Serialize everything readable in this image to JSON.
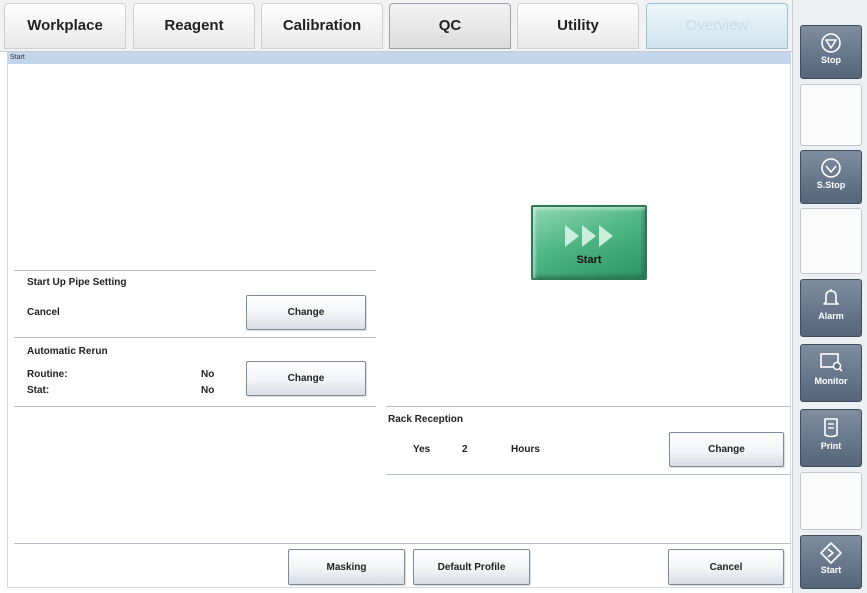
{
  "tabs": [
    {
      "label": "Workplace"
    },
    {
      "label": "Reagent"
    },
    {
      "label": "Calibration"
    },
    {
      "label": "QC"
    },
    {
      "label": "Utility"
    },
    {
      "label": "Overview"
    }
  ],
  "window_title": "Start",
  "start_up_pipe": {
    "heading": "Start Up Pipe Setting",
    "value": "Cancel",
    "change_label": "Change"
  },
  "automatic_rerun": {
    "heading": "Automatic Rerun",
    "routine_label": "Routine:",
    "routine_value": "No",
    "stat_label": "Stat:",
    "stat_value": "No",
    "change_label": "Change"
  },
  "start_button": {
    "label": "Start",
    "color": "#4fb684"
  },
  "rack_reception": {
    "heading": "Rack Reception",
    "value": "Yes",
    "hours": "2",
    "unit": "Hours",
    "change_label": "Change"
  },
  "footer": {
    "masking_label": "Masking",
    "default_profile_label": "Default Profile",
    "cancel_label": "Cancel"
  },
  "sidebar": {
    "stop_label": "Stop",
    "sstop_label": "S.Stop",
    "alarm_label": "Alarm",
    "monitor_label": "Monitor",
    "print_label": "Print",
    "start_label": "Start"
  },
  "colors": {
    "title_bar": "#c2d6ec",
    "sidebar_button": "#6b7a8e",
    "start_green": "#4fb684"
  }
}
